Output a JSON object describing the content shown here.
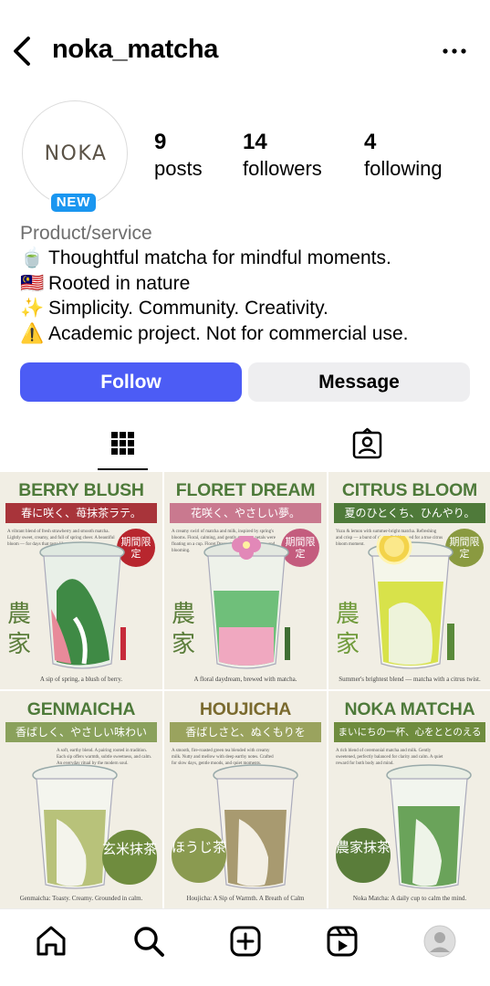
{
  "header": {
    "username": "noka_matcha",
    "back_icon": "chevron-left-icon",
    "more_icon": "ellipsis-icon"
  },
  "profile": {
    "avatar_text": "NOKA",
    "new_badge": "NEW",
    "stats": [
      {
        "num": "9",
        "label": "posts"
      },
      {
        "num": "14",
        "label": "followers"
      },
      {
        "num": "4",
        "label": "following"
      }
    ],
    "category": "Product/service",
    "bio": [
      {
        "emoji": "🍵",
        "text": "Thoughtful matcha for mindful moments."
      },
      {
        "emoji": "🇲🇾",
        "text": "Rooted in nature"
      },
      {
        "emoji": "✨",
        "text": "Simplicity. Community. Creativity."
      },
      {
        "emoji": "⚠️",
        "text": "Academic project. Not for commercial use."
      }
    ]
  },
  "actions": {
    "follow": "Follow",
    "message": "Message"
  },
  "colors": {
    "follow_bg": "#4c5cf5",
    "badge": "#1a96f0"
  },
  "posts": [
    {
      "title": "BERRY BLUSH",
      "subtitle": "春に咲く、苺抹茶ラテ。",
      "desc": "A vibrant blend of fresh strawberry and smooth matcha. Lightly sweet, creamy, and full of spring cheer. A beautiful bloom — for days that taste like sunshine.",
      "badge": "期間限定",
      "side": "農家",
      "foot": "A sip of spring, a blush of berry.",
      "title_color": "#4e7a3a",
      "band_color": "#a8343a",
      "accent": "#d8475a"
    },
    {
      "title": "FLORET DREAM",
      "subtitle": "花咲く、やさしい夢。",
      "desc": "A creamy swirl of matcha and milk, inspired by spring's blooms. Floral, calming, and gently sweet — petals were floating on a cup. Floret Dream is how spring tastes, and blooming.",
      "badge": "期間限定",
      "side": "農家",
      "foot": "A floral daydream, brewed with matcha.",
      "title_color": "#4e7a3a",
      "band_color": "#c9798f",
      "accent": "#c95c82"
    },
    {
      "title": "CITRUS BLOOM",
      "subtitle": "夏のひとくち、ひんやり。",
      "desc": "Yuzu & lemon with summer-bright matcha. Refreshing and crisp — a burst of citrus. Cold brewed for a true citrus bloom moment.",
      "badge": "期間限定",
      "side": "農家",
      "foot": "Summer's brightest blend — matcha with a citrus twist.",
      "title_color": "#4e7a3a",
      "band_color": "#4f7a3a",
      "accent": "#bfa52c"
    },
    {
      "title": "GENMAICHA",
      "subtitle": "香ばしく、やさしい味わい",
      "desc": "A soft, earthy blend. A pairing rooted in tradition. Each sip offers warmth, subtle sweetness, and calm. An everyday ritual by the modern soul.",
      "seal": "玄米抹茶",
      "foot": "Genmaicha: Toasty. Creamy. Grounded in calm.",
      "title_color": "#4e7a3a",
      "band_color": "#8aa15c",
      "accent": "#6f8c3e"
    },
    {
      "title": "HOUJICHA",
      "subtitle": "香ばしさと、ぬくもりを",
      "desc": "A smooth, fire-roasted green tea blended with creamy milk. Nutty and mellow with deep earthy notes. Crafted for slow days, gentle moods, and quiet moments.",
      "seal": "ほうじ茶",
      "foot": "Houjicha: A Sip of Warmth. A Breath of Calm",
      "title_color": "#7a6a2e",
      "band_color": "#9aa35e",
      "accent": "#8a9a50"
    },
    {
      "title": "NOKA MATCHA",
      "subtitle": "まいにちの一杯、心をととのえる",
      "desc": "A rich blend of ceremonial matcha and milk. Gently sweetened, perfectly balanced for clarity and calm. A quiet reward for both body and mind.",
      "seal": "農家抹茶",
      "foot": "Noka Matcha: A daily cup to calm the mind.",
      "title_color": "#4e7a3a",
      "band_color": "#6f8c3e",
      "accent": "#5a7d3a"
    }
  ],
  "bottom_nav": [
    "home-icon",
    "search-icon",
    "create-icon",
    "reels-icon",
    "profile-icon"
  ]
}
